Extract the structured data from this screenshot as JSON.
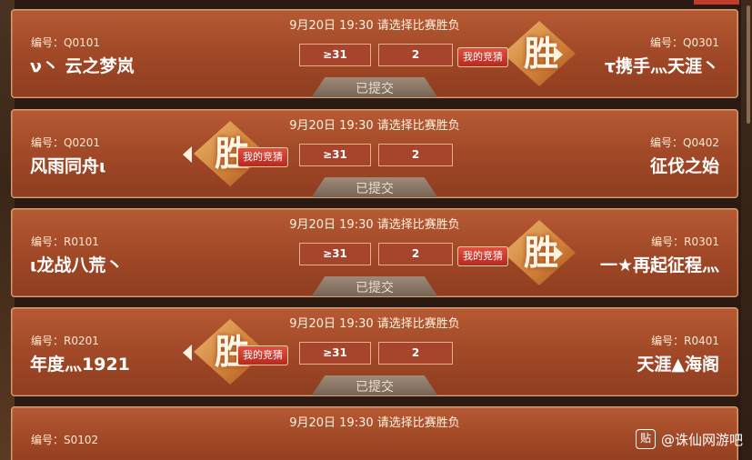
{
  "cards": [
    {
      "header": "9月20日 19:30 请选择比赛胜负",
      "left_id": "编号：Q0101",
      "left_name": "ν丶 云之梦岚",
      "right_id": "编号：Q0301",
      "right_name": "τ携手灬天涯丶",
      "option_a": "≥31",
      "option_b": "2",
      "my_bet_label": "我的竞猜",
      "winner_side": "right",
      "win_glyph": "胜",
      "status": "已提交"
    },
    {
      "header": "9月20日 19:30 请选择比赛胜负",
      "left_id": "编号：Q0201",
      "left_name": "风雨同舟ι",
      "right_id": "编号：Q0402",
      "right_name": "征伐之始",
      "option_a": "≥31",
      "option_b": "2",
      "my_bet_label": "我的竞猜",
      "winner_side": "left",
      "win_glyph": "胜",
      "status": "已提交"
    },
    {
      "header": "9月20日 19:30 请选择比赛胜负",
      "left_id": "编号：R0101",
      "left_name": "ι龙战八荒丶",
      "right_id": "编号：R0301",
      "right_name": "一★再起征程灬",
      "option_a": "≥31",
      "option_b": "2",
      "my_bet_label": "我的竞猜",
      "winner_side": "right",
      "win_glyph": "胜",
      "status": "已提交"
    },
    {
      "header": "9月20日 19:30 请选择比赛胜负",
      "left_id": "编号：R0201",
      "left_name": "年度灬1921",
      "right_id": "编号：R0401",
      "right_name": "天涯▲海阁",
      "option_a": "≥31",
      "option_b": "2",
      "my_bet_label": "我的竞猜",
      "winner_side": "left",
      "win_glyph": "胜",
      "status": "已提交"
    },
    {
      "header": "9月20日 19:30 请选择比赛胜负",
      "left_id": "编号：S0102"
    }
  ],
  "watermark": {
    "logo": "贴",
    "text": "@诛仙网游吧"
  }
}
